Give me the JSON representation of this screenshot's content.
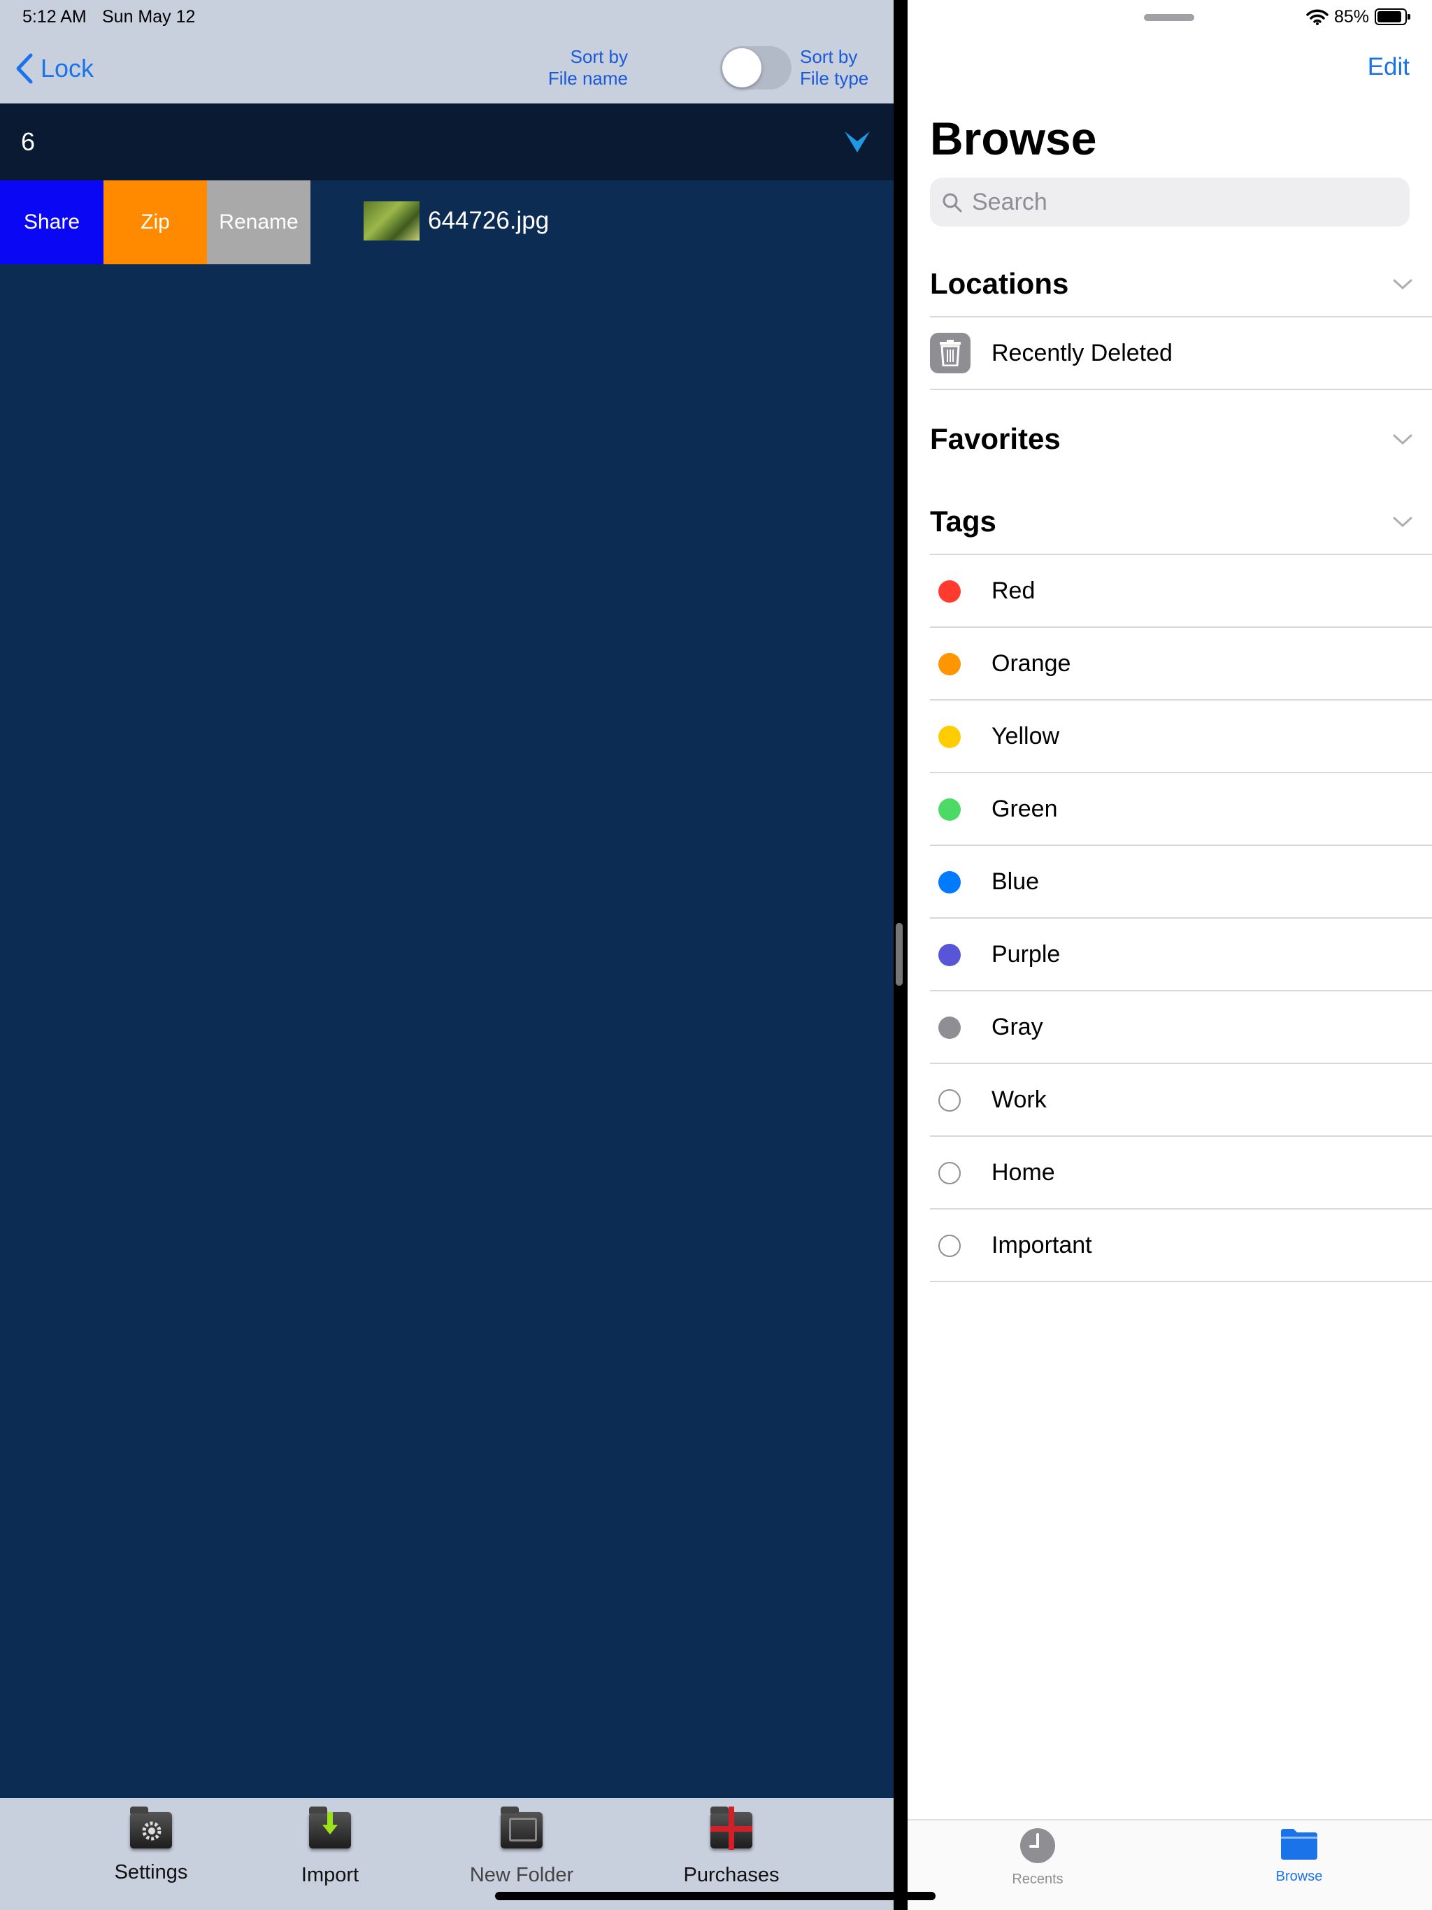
{
  "status": {
    "time": "5:12 AM",
    "date": "Sun May 12",
    "battery": "85%"
  },
  "left": {
    "back_label": "Lock",
    "sort_left": [
      "Sort by",
      "File name"
    ],
    "sort_right": [
      "Sort by",
      "File type"
    ],
    "folder_count": "6",
    "actions": {
      "share": "Share",
      "zip": "Zip",
      "rename": "Rename"
    },
    "file_name": "644726.jpg",
    "tabs": [
      {
        "label": "Settings",
        "icon": "settings-folder-icon"
      },
      {
        "label": "Import",
        "icon": "import-folder-icon"
      },
      {
        "label": "New Folder",
        "icon": "new-folder-icon"
      },
      {
        "label": "Purchases",
        "icon": "purchases-folder-icon"
      }
    ],
    "colors": {
      "share": "#0a07f5",
      "zip": "#ff8a00",
      "rename": "#a9a9a9",
      "background": "#0d2c54"
    }
  },
  "right": {
    "edit": "Edit",
    "title": "Browse",
    "search_placeholder": "Search",
    "sections": {
      "locations": "Locations",
      "favorites": "Favorites",
      "tags": "Tags"
    },
    "locations": [
      {
        "label": "Recently Deleted",
        "icon": "trash-icon"
      }
    ],
    "tags": [
      {
        "label": "Red",
        "color": "#ff3b30"
      },
      {
        "label": "Orange",
        "color": "#ff9500"
      },
      {
        "label": "Yellow",
        "color": "#ffcc00"
      },
      {
        "label": "Green",
        "color": "#4cd964"
      },
      {
        "label": "Blue",
        "color": "#007aff"
      },
      {
        "label": "Purple",
        "color": "#5856d6"
      },
      {
        "label": "Gray",
        "color": "#8e8e93"
      },
      {
        "label": "Work",
        "color": ""
      },
      {
        "label": "Home",
        "color": ""
      },
      {
        "label": "Important",
        "color": ""
      }
    ],
    "tabs": [
      {
        "label": "Recents",
        "icon": "clock-icon"
      },
      {
        "label": "Browse",
        "icon": "folder-icon"
      }
    ]
  }
}
